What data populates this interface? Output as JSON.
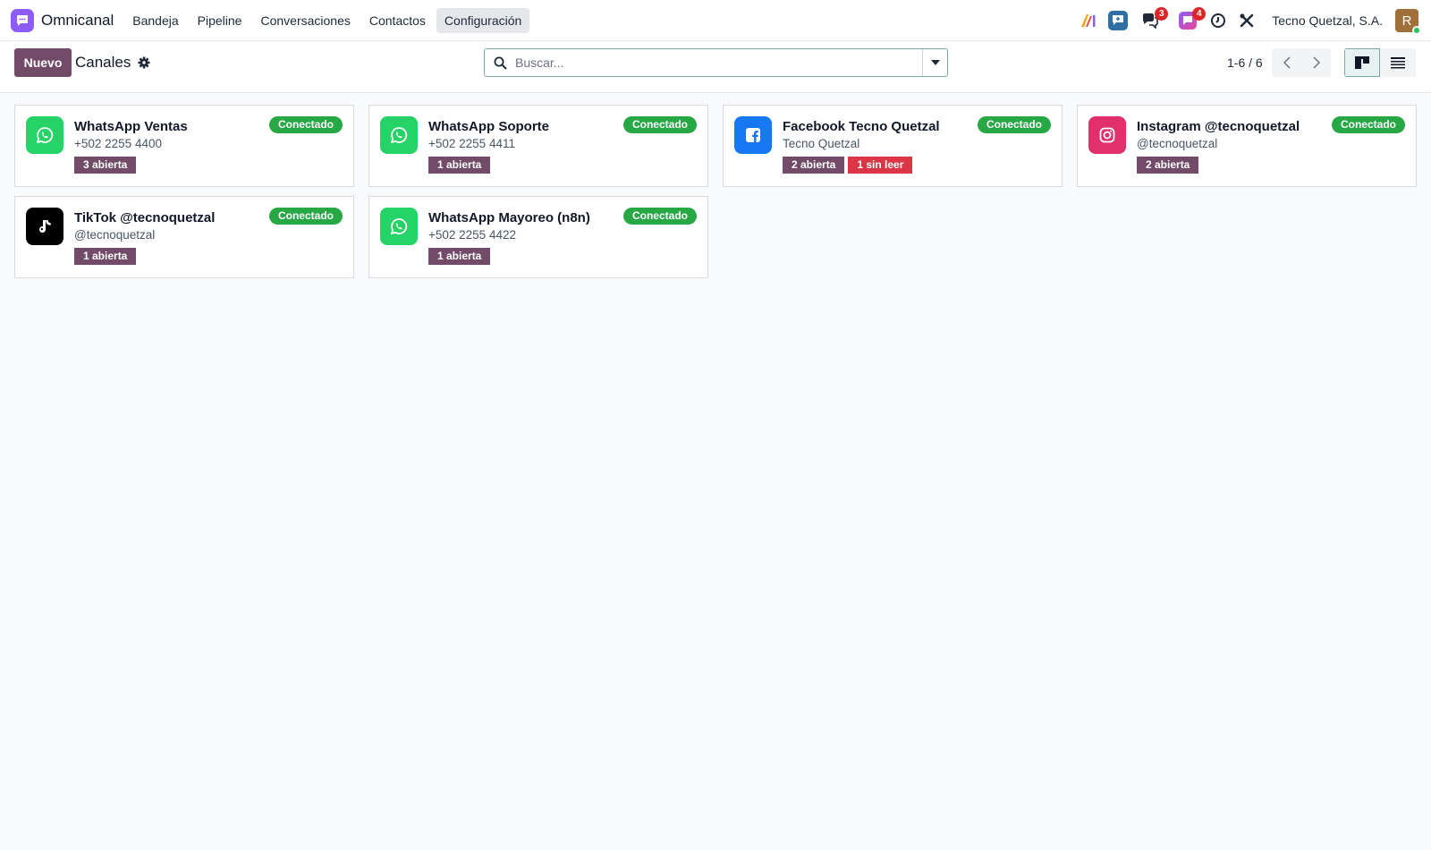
{
  "app": {
    "name": "Omnicanal"
  },
  "menu": [
    {
      "label": "Bandeja",
      "active": false
    },
    {
      "label": "Pipeline",
      "active": false
    },
    {
      "label": "Conversaciones",
      "active": false
    },
    {
      "label": "Contactos",
      "active": false
    },
    {
      "label": "Configuración",
      "active": true
    }
  ],
  "systray": {
    "chat_badge": "3",
    "activity_badge": "4",
    "company": "Tecno Quetzal, S.A.",
    "avatar_initial": "R"
  },
  "control": {
    "new_label": "Nuevo",
    "title": "Canales",
    "search_placeholder": "Buscar...",
    "pager": "1-6 / 6"
  },
  "colors": {
    "primary": "#714b67",
    "connected": "#28a745",
    "unread": "#dc3545",
    "whatsapp": "#25d366",
    "facebook": "#1877f2",
    "instagram": "#e1306c",
    "tiktok": "#000000"
  },
  "channels": [
    {
      "name": "WhatsApp Ventas",
      "subtitle": "+502 2255 4400",
      "status": "Conectado",
      "icon": "whatsapp-icon",
      "open": "3 abierta",
      "unread": ""
    },
    {
      "name": "WhatsApp Soporte",
      "subtitle": "+502 2255 4411",
      "status": "Conectado",
      "icon": "whatsapp-icon",
      "open": "1 abierta",
      "unread": ""
    },
    {
      "name": "Facebook Tecno Quetzal",
      "subtitle": "Tecno Quetzal",
      "status": "Conectado",
      "icon": "facebook-icon",
      "open": "2 abierta",
      "unread": "1 sin leer"
    },
    {
      "name": "Instagram @tecnoquetzal",
      "subtitle": "@tecnoquetzal",
      "status": "Conectado",
      "icon": "instagram-icon",
      "open": "2 abierta",
      "unread": ""
    },
    {
      "name": "TikTok @tecnoquetzal",
      "subtitle": "@tecnoquetzal",
      "status": "Conectado",
      "icon": "tiktok-icon",
      "open": "1 abierta",
      "unread": ""
    },
    {
      "name": "WhatsApp Mayoreo (n8n)",
      "subtitle": "+502 2255 4422",
      "status": "Conectado",
      "icon": "whatsapp-icon",
      "open": "1 abierta",
      "unread": ""
    }
  ]
}
